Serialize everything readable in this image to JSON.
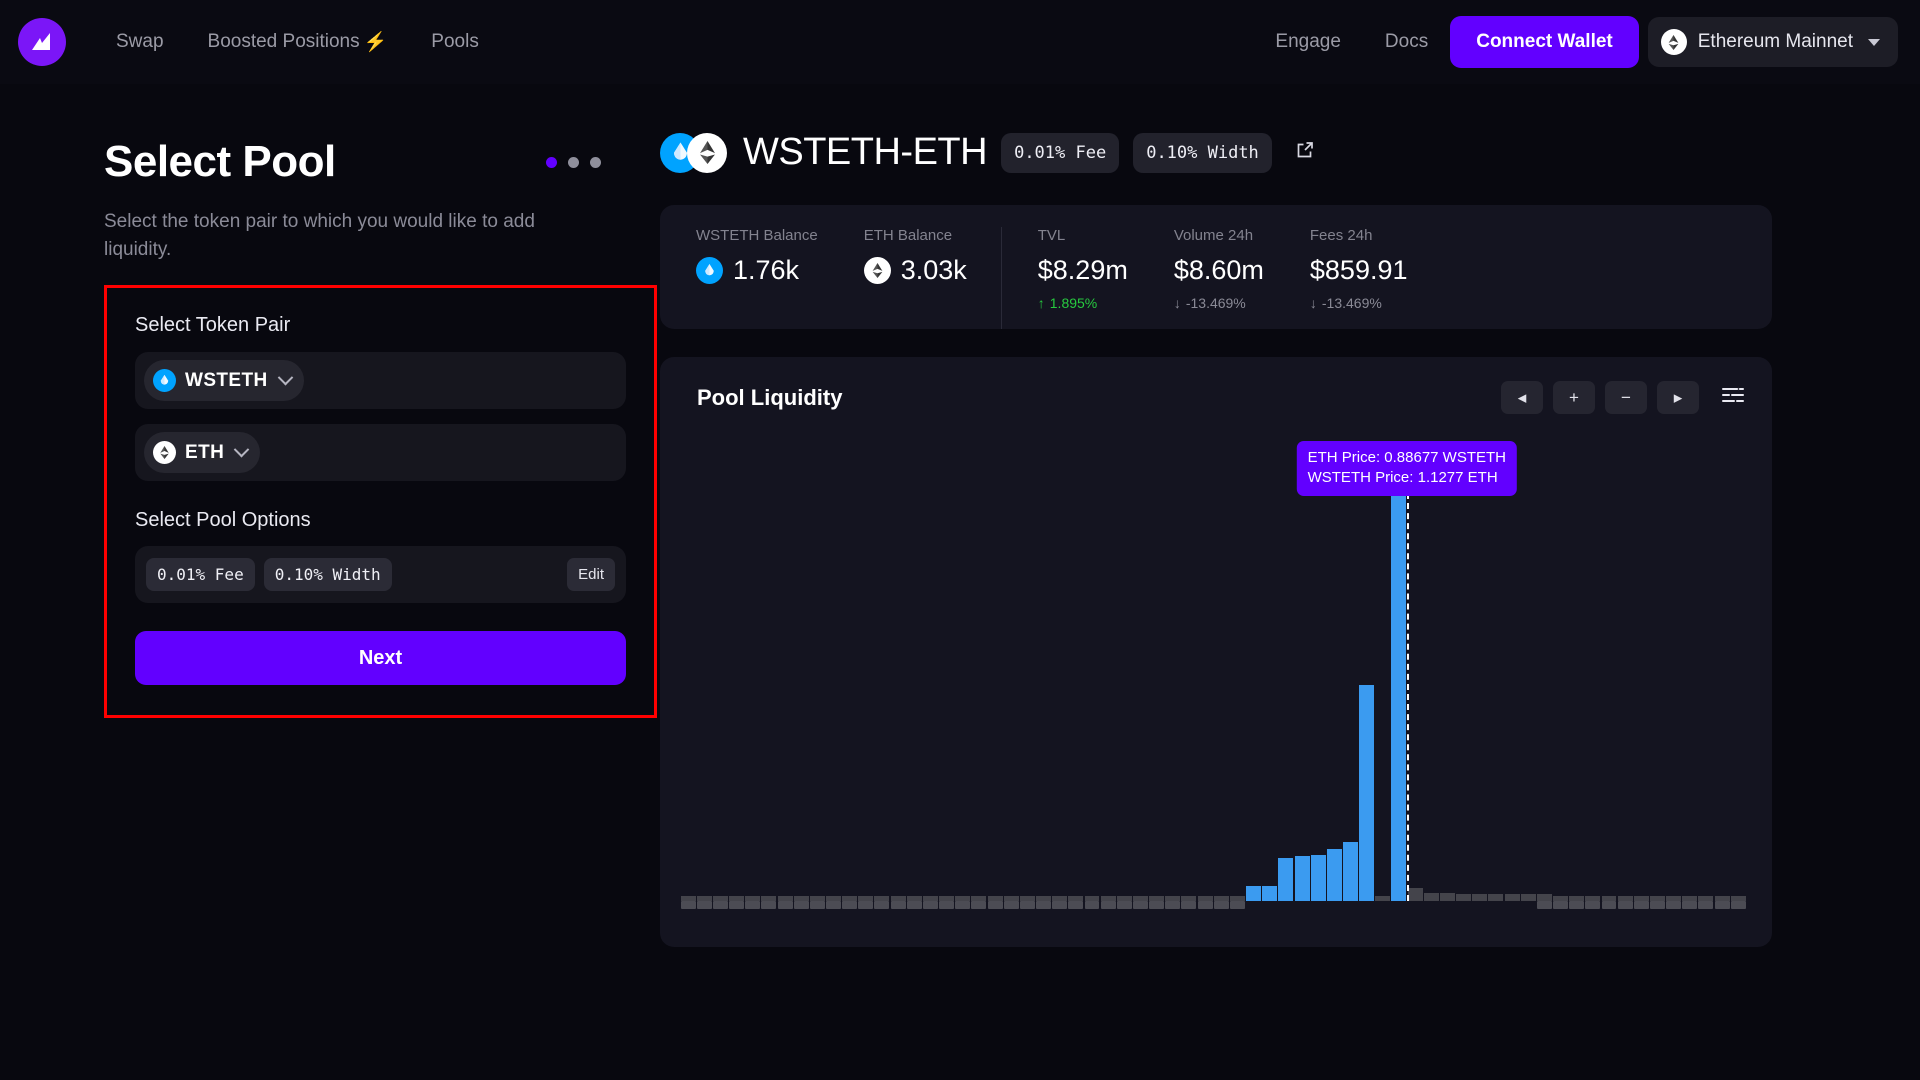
{
  "header": {
    "logo_icon": "cowswap-logo-icon",
    "nav": [
      {
        "label": "Swap",
        "icon": null
      },
      {
        "label": "Boosted Positions",
        "icon": "bolt-icon"
      },
      {
        "label": "Pools",
        "icon": null
      }
    ],
    "links": [
      {
        "label": "Engage"
      },
      {
        "label": "Docs"
      }
    ],
    "connect_label": "Connect Wallet",
    "network_label": "Ethereum Mainnet",
    "network_icon": "ethereum-icon",
    "caret_icon": "chevron-down-icon",
    "accent": "#6200ff"
  },
  "left": {
    "title": "Select Pool",
    "subtitle": "Select the token pair to which you would like to add liquidity.",
    "steps": {
      "count": 3,
      "active": 0,
      "active_color": "#6200ff",
      "inactive_color": "#8f8f9c"
    },
    "highlight_color": "#ff0000",
    "token_pair_label": "Select Token Pair",
    "token_a": {
      "symbol": "WSTETH",
      "icon": "wsteth-icon",
      "chevron": "chevron-down-icon"
    },
    "token_b": {
      "symbol": "ETH",
      "icon": "ethereum-icon",
      "chevron": "chevron-down-icon"
    },
    "pool_options_label": "Select Pool Options",
    "fee_pill": "0.01% Fee",
    "width_pill": "0.10% Width",
    "edit_label": "Edit",
    "next_label": "Next"
  },
  "pool": {
    "name": "WSTETH-ETH",
    "icon_a": "wsteth-icon",
    "icon_b": "ethereum-icon",
    "fee_pill": "0.01% Fee",
    "width_pill": "0.10% Width",
    "external_link_icon": "external-link-icon",
    "stats": [
      {
        "label": "WSTETH Balance",
        "value": "1.76k",
        "icon": "wsteth-icon",
        "delta": null,
        "dir": null
      },
      {
        "label": "ETH Balance",
        "value": "3.03k",
        "icon": "ethereum-icon",
        "delta": null,
        "dir": null
      },
      {
        "label": "TVL",
        "value": "$8.29m",
        "icon": null,
        "delta": "1.895%",
        "dir": "up"
      },
      {
        "label": "Volume 24h",
        "value": "$8.60m",
        "icon": null,
        "delta": "-13.469%",
        "dir": "down"
      },
      {
        "label": "Fees 24h",
        "value": "$859.91",
        "icon": null,
        "delta": "-13.469%",
        "dir": "down"
      }
    ]
  },
  "chart": {
    "title": "Pool Liquidity",
    "controls": [
      {
        "name": "pan-left-button",
        "glyph": "◂"
      },
      {
        "name": "zoom-in-button",
        "glyph": "+"
      },
      {
        "name": "zoom-out-button",
        "glyph": "−"
      },
      {
        "name": "pan-right-button",
        "glyph": "▸"
      }
    ],
    "settings_icon": "sliders-icon",
    "tooltip": {
      "line1": "ETH Price:  0.88677 WSTETH",
      "line2": "WSTETH Price:  1.1277 ETH",
      "bg": "#6200ff"
    }
  },
  "chart_data": {
    "type": "bar",
    "title": "Pool Liquidity",
    "xlabel": "",
    "ylabel": "",
    "grid": false,
    "legend": null,
    "active_color": "#3b9bf0",
    "inactive_color": "#4c4c54",
    "current_price_marker": {
      "x_index": 44,
      "style": "dashed-white-vertical"
    },
    "annotations": [
      "ETH Price:  0.88677 WSTETH",
      "WSTETH Price:  1.1277 ETH"
    ],
    "n_bins": 66,
    "values": [
      0.008,
      0.008,
      0.008,
      0.008,
      0.008,
      0.008,
      0.008,
      0.008,
      0.008,
      0.008,
      0.008,
      0.008,
      0.008,
      0.008,
      0.008,
      0.008,
      0.008,
      0.008,
      0.008,
      0.008,
      0.008,
      0.008,
      0.008,
      0.008,
      0.008,
      0.008,
      0.008,
      0.008,
      0.008,
      0.008,
      0.008,
      0.008,
      0.008,
      0.008,
      0.008,
      0.03,
      0.03,
      0.085,
      0.09,
      0.092,
      0.103,
      0.118,
      0.43,
      0.008,
      0.915,
      0.025,
      0.015,
      0.015,
      0.014,
      0.014,
      0.014,
      0.014,
      0.014,
      0.014,
      0.008,
      0.008,
      0.008,
      0.008,
      0.008,
      0.008,
      0.008,
      0.008,
      0.008,
      0.008,
      0.008,
      0.008
    ],
    "series_state": [
      "inactive",
      "inactive",
      "inactive",
      "inactive",
      "inactive",
      "inactive",
      "inactive",
      "inactive",
      "inactive",
      "inactive",
      "inactive",
      "inactive",
      "inactive",
      "inactive",
      "inactive",
      "inactive",
      "inactive",
      "inactive",
      "inactive",
      "inactive",
      "inactive",
      "inactive",
      "inactive",
      "inactive",
      "inactive",
      "inactive",
      "inactive",
      "inactive",
      "inactive",
      "inactive",
      "inactive",
      "inactive",
      "inactive",
      "inactive",
      "inactive",
      "active",
      "active",
      "active",
      "active",
      "active",
      "active",
      "active",
      "active",
      "inactive",
      "active",
      "inactive",
      "inactive",
      "inactive",
      "inactive",
      "inactive",
      "inactive",
      "inactive",
      "inactive",
      "inactive",
      "inactive",
      "inactive",
      "inactive",
      "inactive",
      "inactive",
      "inactive",
      "inactive",
      "inactive",
      "inactive",
      "inactive",
      "inactive",
      "inactive"
    ],
    "tick_visible": [
      true,
      true,
      true,
      true,
      true,
      true,
      true,
      true,
      true,
      true,
      true,
      true,
      true,
      true,
      true,
      true,
      true,
      true,
      true,
      true,
      true,
      true,
      true,
      true,
      true,
      true,
      true,
      true,
      true,
      true,
      true,
      true,
      true,
      true,
      true,
      false,
      false,
      false,
      false,
      false,
      false,
      false,
      false,
      false,
      false,
      false,
      false,
      false,
      false,
      false,
      false,
      false,
      false,
      true,
      true,
      true,
      true,
      true,
      true,
      true,
      true,
      true,
      true,
      true,
      true,
      true
    ]
  }
}
